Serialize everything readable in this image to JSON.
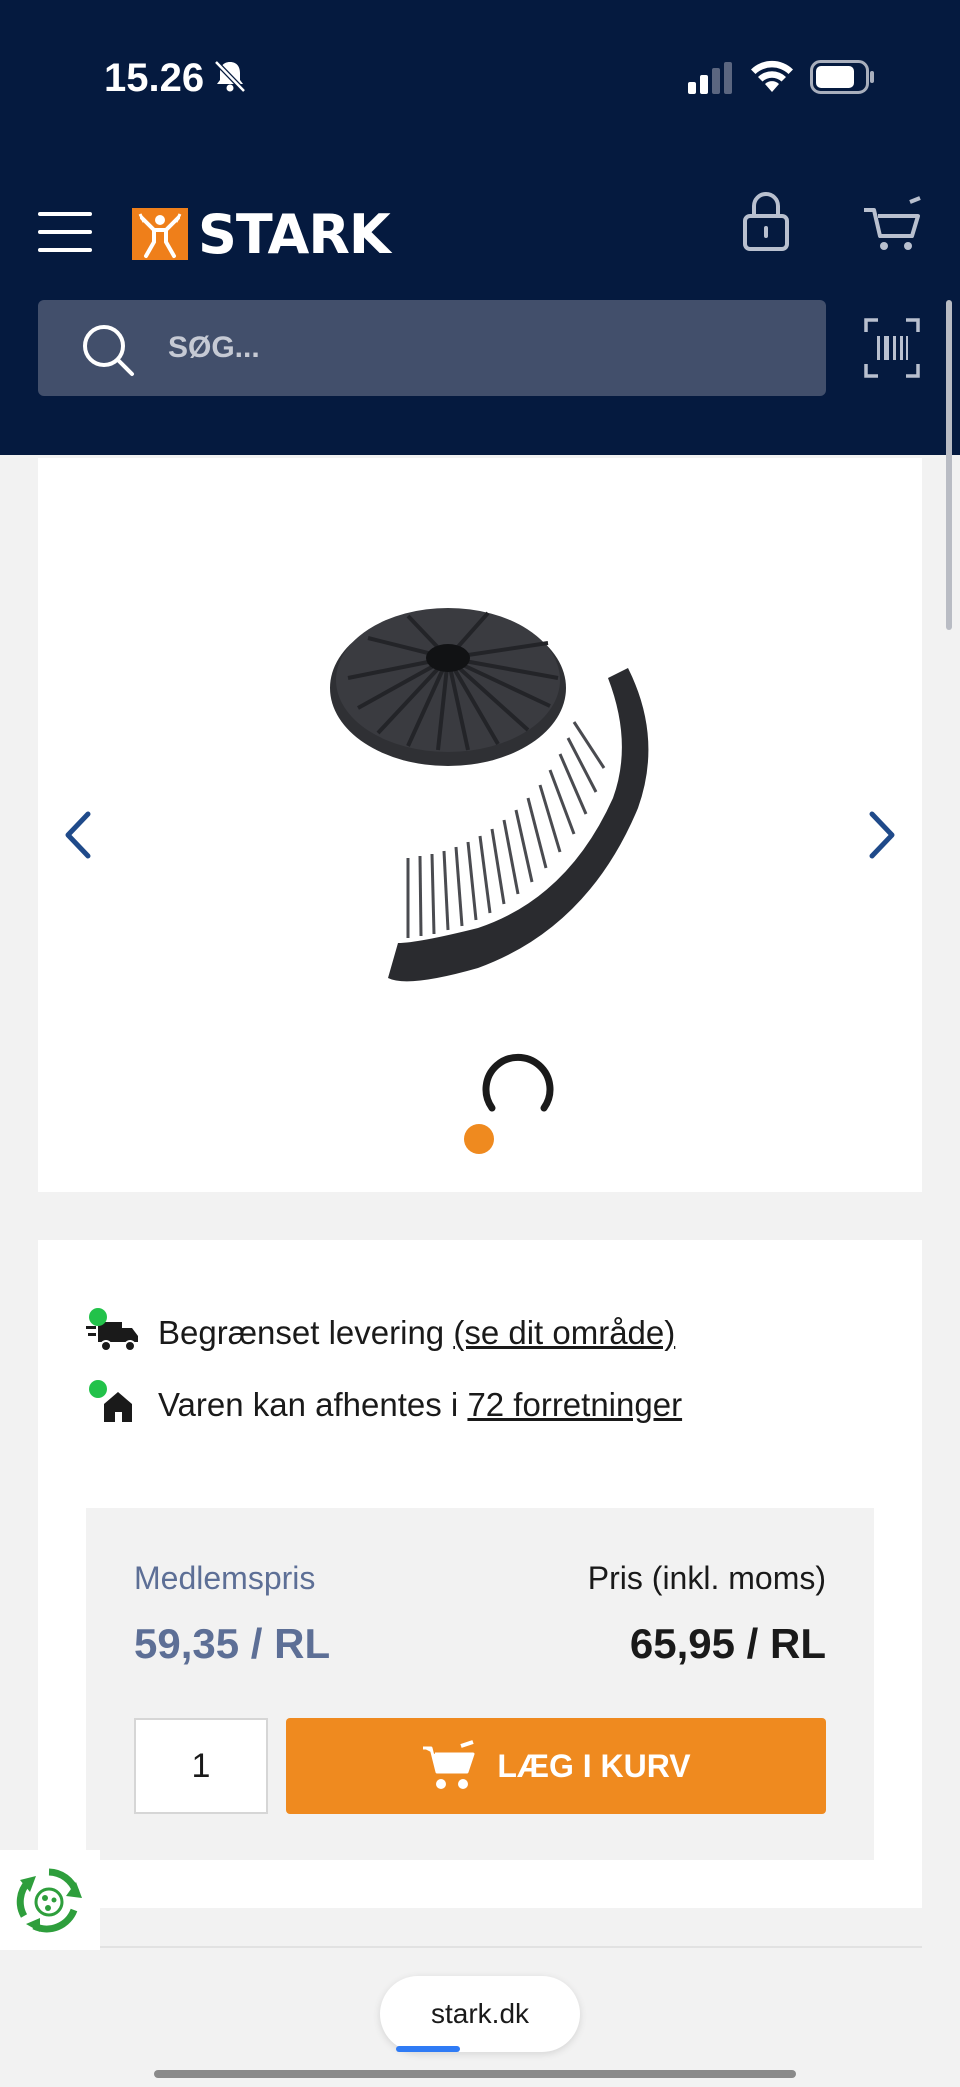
{
  "status_bar": {
    "time": "15.26"
  },
  "header": {
    "brand": "STARK",
    "search": {
      "placeholder": "SØG...",
      "value": ""
    }
  },
  "product": {
    "image_alt": "Spiral plastic fiber strip product",
    "carousel": {
      "active_index": 1
    }
  },
  "availability": {
    "delivery_text": "Begrænset levering ",
    "delivery_link": "(se dit område)",
    "pickup_text": "Varen kan afhentes i ",
    "pickup_link": "72 forretninger",
    "status_color": "#22c24a"
  },
  "pricing": {
    "member_label": "Medlemspris",
    "member_price": "59,35 / RL",
    "price_label": "Pris (inkl. moms)",
    "price_value": "65,95 / RL",
    "quantity": "1",
    "add_to_cart_label": "LÆG I KURV"
  },
  "browser": {
    "url": "stark.dk"
  },
  "colors": {
    "header_bg": "#051a3f",
    "accent": "#ef8a1f",
    "member_price": "#5d6f96"
  }
}
